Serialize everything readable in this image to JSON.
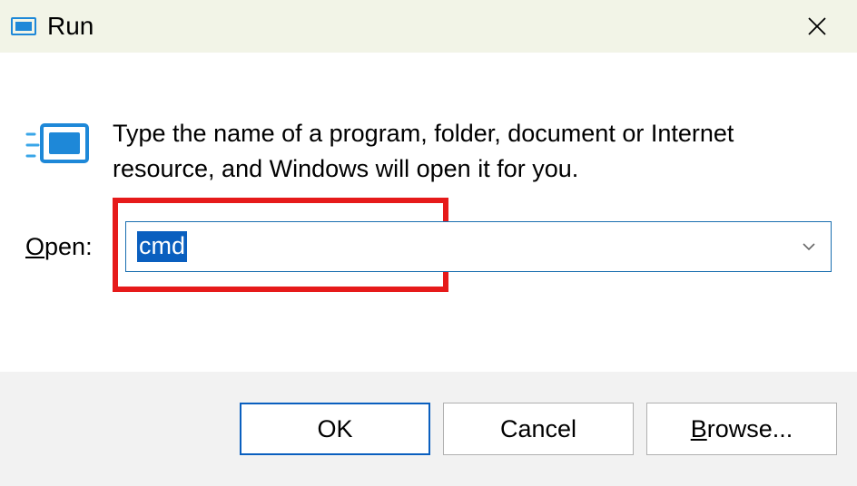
{
  "titlebar": {
    "title": "Run"
  },
  "description": "Type the name of a program, folder, document or Internet resource, and Windows will open it for you.",
  "input": {
    "label_prefix": "O",
    "label_rest": "pen:",
    "value": "cmd"
  },
  "buttons": {
    "ok": "OK",
    "cancel": "Cancel",
    "browse_prefix": "B",
    "browse_rest": "rowse..."
  }
}
